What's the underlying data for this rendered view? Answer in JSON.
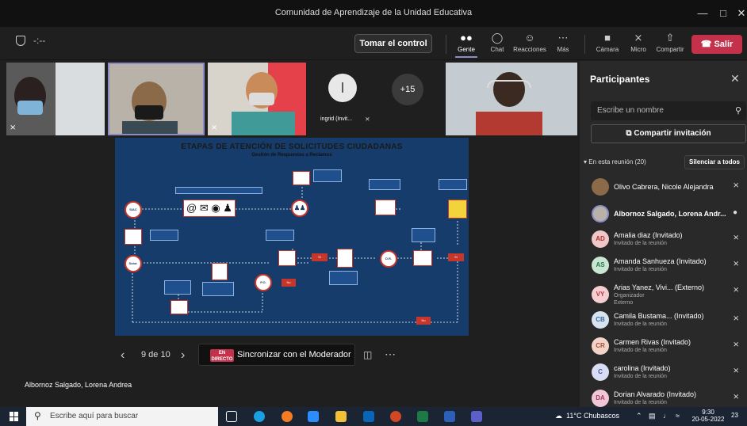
{
  "window": {
    "title": "Comunidad de Aprendizaje de la Unidad Educativa"
  },
  "toolbar": {
    "timer": "-:--",
    "take_control": "Tomar el control",
    "people": "Gente",
    "chat": "Chat",
    "reactions": "Reacciones",
    "more": "Más",
    "camera": "Cámara",
    "mic": "Micro",
    "share": "Compartir",
    "leave": "Salir"
  },
  "tiles": {
    "ingrid_name": "ingrid (Invit...",
    "ingrid_initial": "I",
    "overflow": "+15"
  },
  "slide": {
    "title": "ETAPAS DE ATENCIÓN DE SOLICITUDES CIUDADANAS",
    "subtitle": "Gestión de Respuestas a Reclamos",
    "nodes": [
      "SIAC",
      "Subd.",
      "P.O.",
      "D.R."
    ],
    "tags": {
      "si1": "Sí",
      "si2": "Sí",
      "no1": "No",
      "no2": "No"
    }
  },
  "nav": {
    "page": "9 de 10",
    "live_1": "EN",
    "live_2": "DIRECTO",
    "sync": "Sincronizar con el Moderador"
  },
  "presenter": "Albornoz Salgado, Lorena Andrea",
  "panel": {
    "title": "Participantes",
    "search_placeholder": "Escribe un nombre",
    "share_invite": "Compartir invitación",
    "in_meeting": "En esta reunión (20)",
    "mute_all": "Silenciar a todos",
    "people": [
      {
        "name": "Olivo Cabrera, Nicole Alejandra",
        "role": "",
        "initials": ""
      },
      {
        "name": "Albornoz Salgado, Lorena Andr...",
        "role": "",
        "initials": ""
      },
      {
        "name": "Amalia diaz (Invitado)",
        "role": "Invitado de la reunión",
        "initials": "AD"
      },
      {
        "name": "Amanda Sanhueza (Invitado)",
        "role": "Invitado de la reunión",
        "initials": "AS"
      },
      {
        "name": "Arias Yanez, Vivi... (Externo)",
        "role": "Organizador",
        "role2": "Externo",
        "initials": "VY"
      },
      {
        "name": "Camila Bustama... (Invitado)",
        "role": "Invitado de la reunión",
        "initials": "CB"
      },
      {
        "name": "Carmen Rivas (Invitado)",
        "role": "Invitado de la reunión",
        "initials": "CR"
      },
      {
        "name": "carolina (Invitado)",
        "role": "Invitado de la reunión",
        "initials": "C"
      },
      {
        "name": "Dorian Alvarado (Invitado)",
        "role": "Invitado de la reunión",
        "initials": "DA"
      }
    ]
  },
  "taskbar": {
    "search_placeholder": "Escribe aquí para buscar",
    "weather": "11°C Chubascos",
    "time": "9:30",
    "date": "20-05-2022",
    "badge": "23"
  },
  "colors": {
    "accent": "#8b8cc7",
    "leave": "#c4314b",
    "slide_bg": "#163c6b"
  }
}
